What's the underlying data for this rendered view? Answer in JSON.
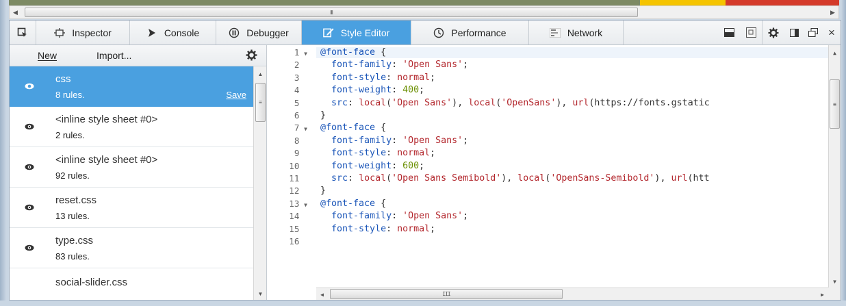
{
  "toolbar": {
    "tabs": [
      {
        "label": "Inspector",
        "icon": "inspector-frame-icon"
      },
      {
        "label": "Console",
        "icon": "console-chevron-icon"
      },
      {
        "label": "Debugger",
        "icon": "debugger-pause-icon"
      },
      {
        "label": "Style Editor",
        "icon": "style-editor-pencil-icon",
        "active": true
      },
      {
        "label": "Performance",
        "icon": "performance-clock-icon"
      },
      {
        "label": "Network",
        "icon": "network-icon"
      }
    ],
    "pick_icon": "element-picker-icon",
    "right_icons": [
      "split-console-icon",
      "scratchpad-icon",
      "settings-gear-icon",
      "dock-side-icon",
      "undock-window-icon",
      "close-icon"
    ],
    "close_glyph": "×",
    "hscroll_glyph": "III"
  },
  "sidebar": {
    "new_label": "New",
    "import_label": "Import...",
    "gear_icon": "options-gear-icon",
    "sheets": [
      {
        "name": "css",
        "rules": "8 rules.",
        "selected": true,
        "save": "Save"
      },
      {
        "name": "<inline style sheet #0>",
        "rules": "2 rules."
      },
      {
        "name": "<inline style sheet #0>",
        "rules": "92 rules."
      },
      {
        "name": "reset.css",
        "rules": "13 rules."
      },
      {
        "name": "type.css",
        "rules": "83 rules."
      },
      {
        "name": "social-slider.css",
        "rules": ""
      }
    ]
  },
  "editor": {
    "line_numbers": [
      "1",
      "2",
      "3",
      "4",
      "5",
      "6",
      "7",
      "8",
      "9",
      "10",
      "11",
      "12",
      "13",
      "14",
      "15",
      "16"
    ],
    "code_lines": [
      "@font-face {",
      "  font-family: 'Open Sans';",
      "  font-style: normal;",
      "  font-weight: 400;",
      "  src: local('Open Sans'), local('OpenSans'), url(https://fonts.gstatic",
      "}",
      "@font-face {",
      "  font-family: 'Open Sans';",
      "  font-style: normal;",
      "  font-weight: 600;",
      "  src: local('Open Sans Semibold'), local('OpenSans-Semibold'), url(htt",
      "}",
      "@font-face {",
      "  font-family: 'Open Sans';",
      "  font-style: normal;",
      ""
    ]
  },
  "colors": {
    "accent": "#4aa0e0",
    "at_rule": "#1a55b8",
    "string": "#b3272d",
    "number": "#6a8f00"
  }
}
